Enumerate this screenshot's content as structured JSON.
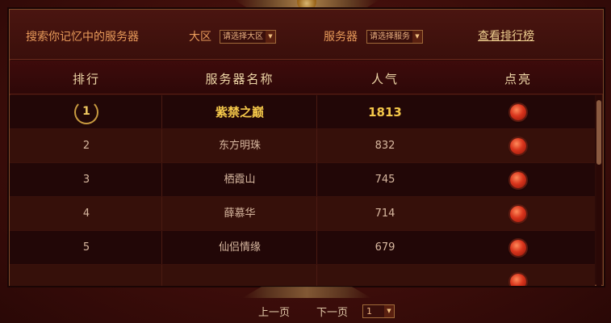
{
  "search": {
    "label": "搜索你记忆中的服务器",
    "region_label": "大区",
    "region_select_value": "请选择大区",
    "server_label": "服务器",
    "server_select_value": "请选择服务",
    "ranking_link": "查看排行榜"
  },
  "table": {
    "headers": {
      "rank": "排行",
      "name": "服务器名称",
      "popularity": "人气",
      "light": "点亮"
    },
    "rows": [
      {
        "rank": "1",
        "name": "紫禁之巅",
        "popularity": "1813"
      },
      {
        "rank": "2",
        "name": "东方明珠",
        "popularity": "832"
      },
      {
        "rank": "3",
        "name": "栖霞山",
        "popularity": "745"
      },
      {
        "rank": "4",
        "name": "薛慕华",
        "popularity": "714"
      },
      {
        "rank": "5",
        "name": "仙侣情缘",
        "popularity": "679"
      }
    ]
  },
  "pagination": {
    "prev_label": "上一页",
    "next_label": "下一页",
    "current_page": "1"
  },
  "icons": {
    "rank_badge": "laurel-icon",
    "light_button": "red-orb-icon",
    "dropdown": "triangle-down-icon"
  },
  "colors": {
    "accent": "#e89a5a",
    "highlight": "#f5c84a",
    "background": "#3c0d0a"
  }
}
